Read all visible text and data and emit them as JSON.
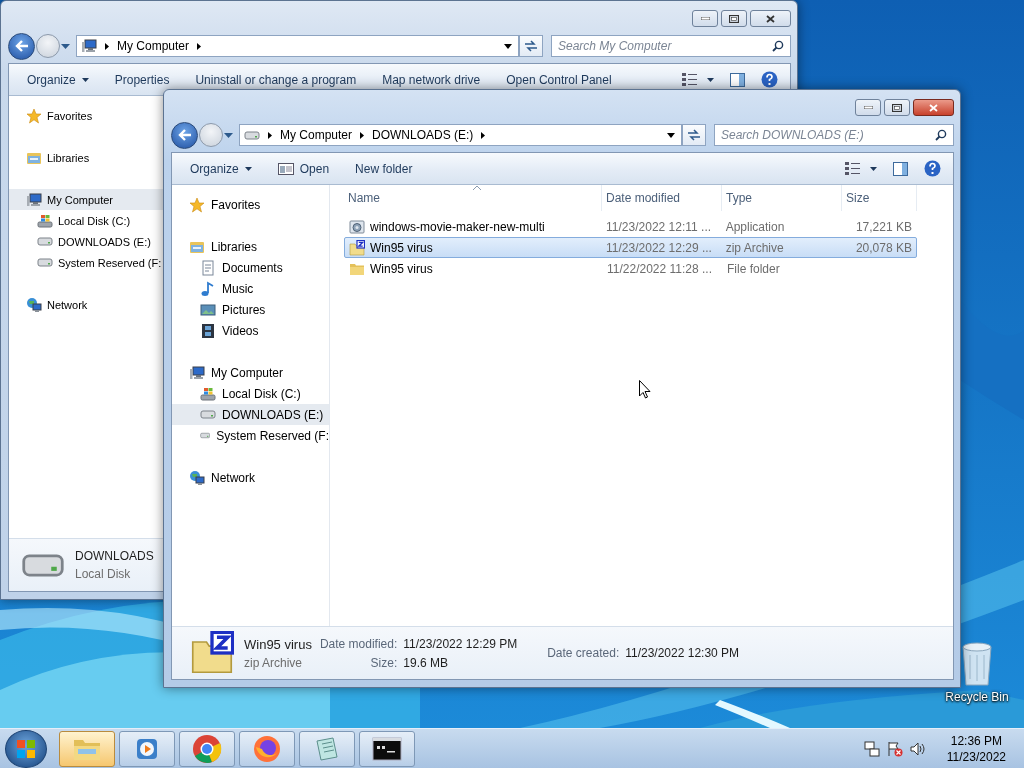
{
  "windows": [
    {
      "active": false,
      "address": {
        "crumbs": [
          "My Computer"
        ]
      },
      "search": {
        "placeholder": "Search My Computer"
      },
      "toolbar": [
        {
          "label": "Organize",
          "kind": "menu"
        },
        {
          "label": "Properties",
          "kind": "button"
        },
        {
          "label": "Uninstall or change a program",
          "kind": "button"
        },
        {
          "label": "Map network drive",
          "kind": "button"
        },
        {
          "label": "Open Control Panel",
          "kind": "button"
        }
      ],
      "nav": [
        {
          "label": "Favorites",
          "kind": "star",
          "selected": false
        },
        {
          "label": "Libraries",
          "kind": "library",
          "selected": false
        },
        {
          "label": "My Computer",
          "kind": "computer",
          "selected": true,
          "children": [
            {
              "label": "Local Disk (C:)",
              "kind": "system-drive",
              "selected": false
            },
            {
              "label": "DOWNLOADS (E:)",
              "kind": "drive",
              "selected": false
            },
            {
              "label": "System Reserved (F:",
              "kind": "drive",
              "selected": false
            }
          ]
        },
        {
          "label": "Network",
          "kind": "network",
          "selected": false
        }
      ],
      "details": {
        "kind": "drive",
        "name": "DOWNLOADS",
        "type": "Local Disk"
      }
    },
    {
      "active": true,
      "address": {
        "crumbs": [
          "My Computer",
          "DOWNLOADS (E:)"
        ]
      },
      "search": {
        "placeholder": "Search DOWNLOADS (E:)"
      },
      "toolbar": [
        {
          "label": "Organize",
          "kind": "menu"
        },
        {
          "label": "Open",
          "kind": "open"
        },
        {
          "label": "New folder",
          "kind": "button"
        }
      ],
      "nav": [
        {
          "label": "Favorites",
          "kind": "star",
          "selected": false
        },
        {
          "label": "Libraries",
          "kind": "library",
          "selected": false,
          "children": [
            {
              "label": "Documents",
              "kind": "documents",
              "selected": false
            },
            {
              "label": "Music",
              "kind": "music",
              "selected": false
            },
            {
              "label": "Pictures",
              "kind": "pictures",
              "selected": false
            },
            {
              "label": "Videos",
              "kind": "videos",
              "selected": false
            }
          ]
        },
        {
          "label": "My Computer",
          "kind": "computer",
          "selected": false,
          "children": [
            {
              "label": "Local Disk (C:)",
              "kind": "system-drive",
              "selected": false
            },
            {
              "label": "DOWNLOADS (E:)",
              "kind": "drive",
              "selected": true
            },
            {
              "label": "System Reserved (F:",
              "kind": "drive",
              "selected": false
            }
          ]
        },
        {
          "label": "Network",
          "kind": "network",
          "selected": false
        }
      ],
      "file_list": {
        "columns": [
          {
            "label": "Name",
            "sorted": true
          },
          {
            "label": "Date modified",
            "sorted": false
          },
          {
            "label": "Type",
            "sorted": false
          },
          {
            "label": "Size",
            "sorted": false
          }
        ],
        "rows": [
          {
            "kind": "app",
            "name": "windows-movie-maker-new-multi",
            "date": "11/23/2022 12:11 ...",
            "type": "Application",
            "size": "17,221 KB",
            "selected": false
          },
          {
            "kind": "zip",
            "name": "Win95 virus",
            "date": "11/23/2022 12:29 ...",
            "type": "zip Archive",
            "size": "20,078 KB",
            "selected": true
          },
          {
            "kind": "folder",
            "name": "Win95 virus",
            "date": "11/22/2022 11:28 ...",
            "type": "File folder",
            "selected": false
          }
        ]
      },
      "details": {
        "kind": "zip",
        "name": "Win95 virus",
        "type": "zip Archive",
        "field_columns": [
          [
            {
              "label": "Date modified:",
              "value": "11/23/2022 12:29 PM"
            },
            {
              "label": "Size:",
              "value": "19.6 MB"
            }
          ],
          [
            {
              "label": "Date created:",
              "value": "11/23/2022 12:30 PM"
            }
          ]
        ]
      }
    }
  ],
  "desktop": {
    "recycle_bin": {
      "label": "Recycle Bin"
    }
  },
  "taskbar": {
    "buttons": [
      {
        "kind": "explorer",
        "selected": true
      },
      {
        "kind": "media",
        "selected": false
      },
      {
        "kind": "chrome",
        "selected": false
      },
      {
        "kind": "firefox",
        "selected": false
      },
      {
        "kind": "notepad",
        "selected": false
      },
      {
        "kind": "cmd",
        "selected": false
      }
    ],
    "tray": [
      {
        "kind": "network"
      },
      {
        "kind": "flag"
      },
      {
        "kind": "volume"
      }
    ],
    "clock": {
      "time": "12:36 PM",
      "date": "11/23/2022"
    }
  }
}
